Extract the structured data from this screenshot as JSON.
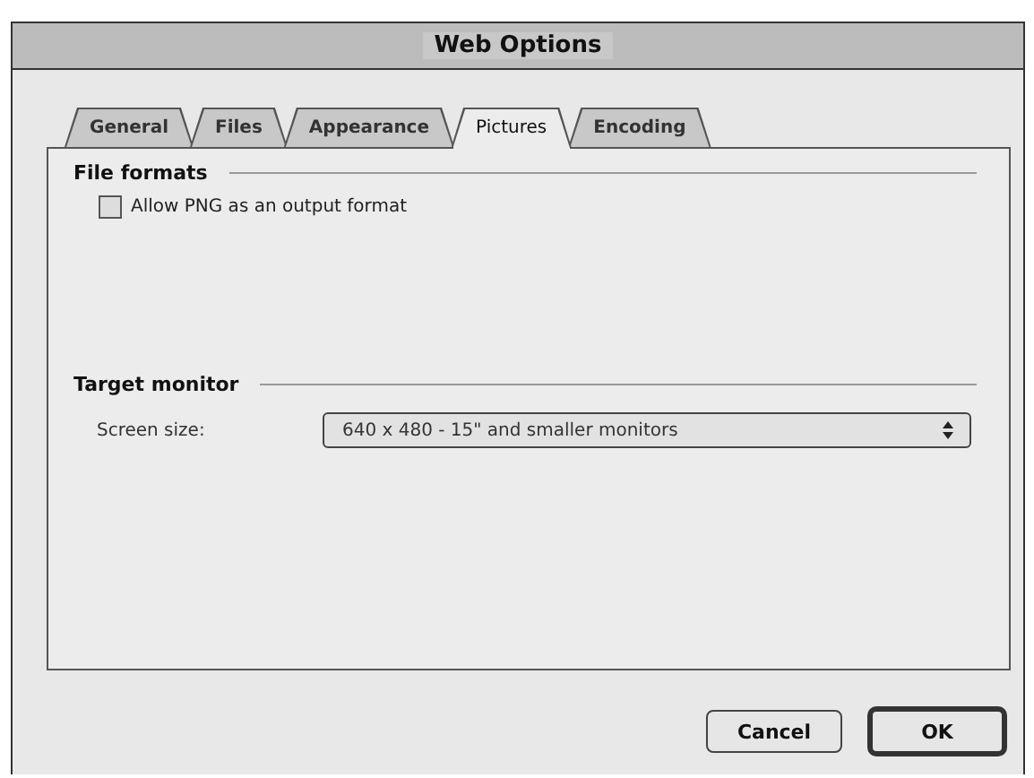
{
  "window": {
    "title": "Web Options"
  },
  "tabs": [
    {
      "label": "General",
      "selected": false
    },
    {
      "label": "Files",
      "selected": false
    },
    {
      "label": "Appearance",
      "selected": false
    },
    {
      "label": "Pictures",
      "selected": true
    },
    {
      "label": "Encoding",
      "selected": false
    }
  ],
  "file_formats": {
    "heading": "File formats",
    "checkbox": {
      "label": "Allow PNG as an output format",
      "checked": false
    }
  },
  "target_monitor": {
    "heading": "Target monitor",
    "screen_size": {
      "label": "Screen size:",
      "value": "640 x 480 - 15\" and smaller monitors"
    }
  },
  "buttons": [
    {
      "label": "Cancel",
      "default": false
    },
    {
      "label": "OK",
      "default": true
    }
  ]
}
